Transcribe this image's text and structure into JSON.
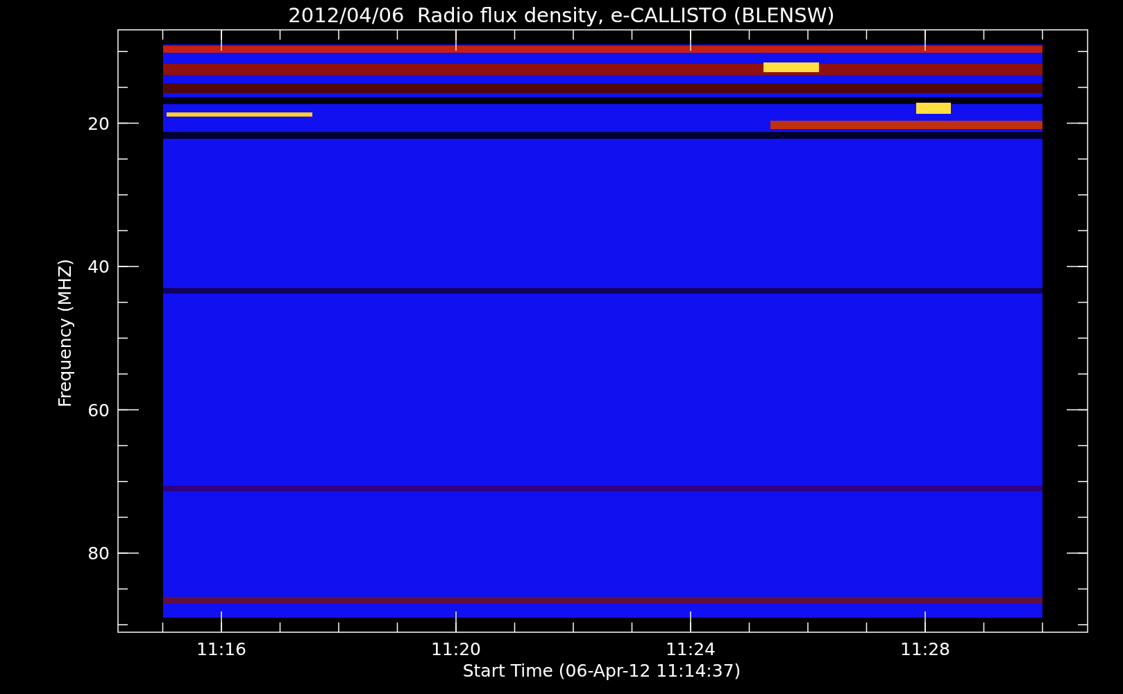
{
  "title": "2012/04/06  Radio flux density, e-CALLISTO (BLENSW)",
  "y_axis": {
    "label": "Frequency (MHZ)",
    "ticks": [
      "20",
      "40",
      "60",
      "80"
    ]
  },
  "x_axis": {
    "label": "Start Time (06-Apr-12 11:14:37)",
    "ticks": [
      "11:16",
      "11:20",
      "11:24",
      "11:28"
    ]
  }
}
